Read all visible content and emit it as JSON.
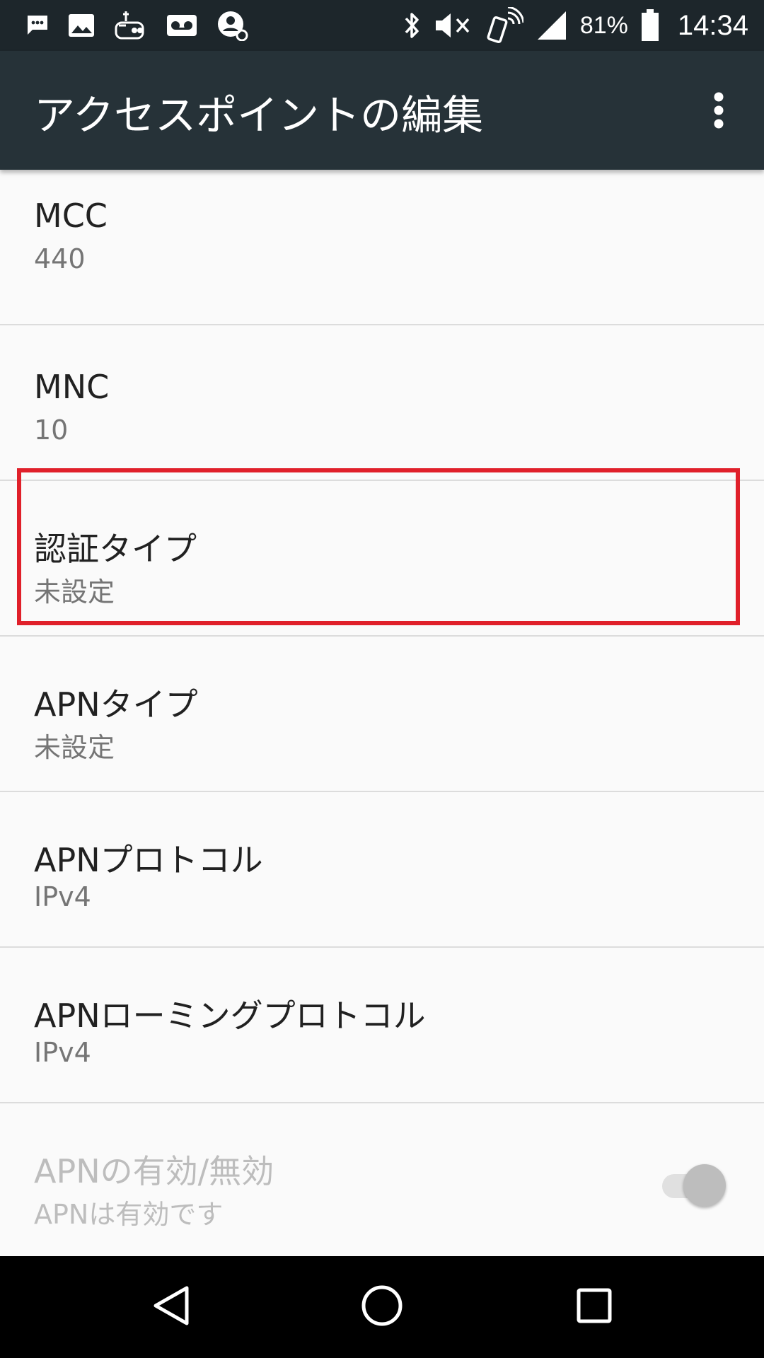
{
  "status_bar": {
    "left_icons": [
      "message-icon",
      "image-icon",
      "robot-icon",
      "voicemail-icon",
      "account-icon"
    ],
    "right_icons": [
      "bluetooth-icon",
      "mute-icon",
      "nfc-phone-icon",
      "signal-icon",
      "battery-icon"
    ],
    "battery_percent": "81%",
    "time": "14:34"
  },
  "toolbar": {
    "title": "アクセスポイントの編集",
    "overflow_icon": "more-vertical-icon"
  },
  "preferences": [
    {
      "title": "MCC",
      "summary": "440",
      "enabled": true
    },
    {
      "title": "MNC",
      "summary": "10",
      "enabled": true
    },
    {
      "title": "認証タイプ",
      "summary": "未設定",
      "enabled": true,
      "highlighted": true
    },
    {
      "title": "APNタイプ",
      "summary": "未設定",
      "enabled": true
    },
    {
      "title": "APNプロトコル",
      "summary": "IPv4",
      "enabled": true
    },
    {
      "title": "APNローミングプロトコル",
      "summary": "IPv4",
      "enabled": true
    },
    {
      "title": "APNの有効/無効",
      "summary": "APNは有効です",
      "enabled": false,
      "toggle": true,
      "toggle_on": true
    }
  ],
  "colors": {
    "status_bar": "#1d262b",
    "toolbar": "#263238",
    "highlight": "#e0202a"
  },
  "nav_bar": {
    "icons": [
      "back-icon",
      "home-icon",
      "recents-icon"
    ]
  }
}
